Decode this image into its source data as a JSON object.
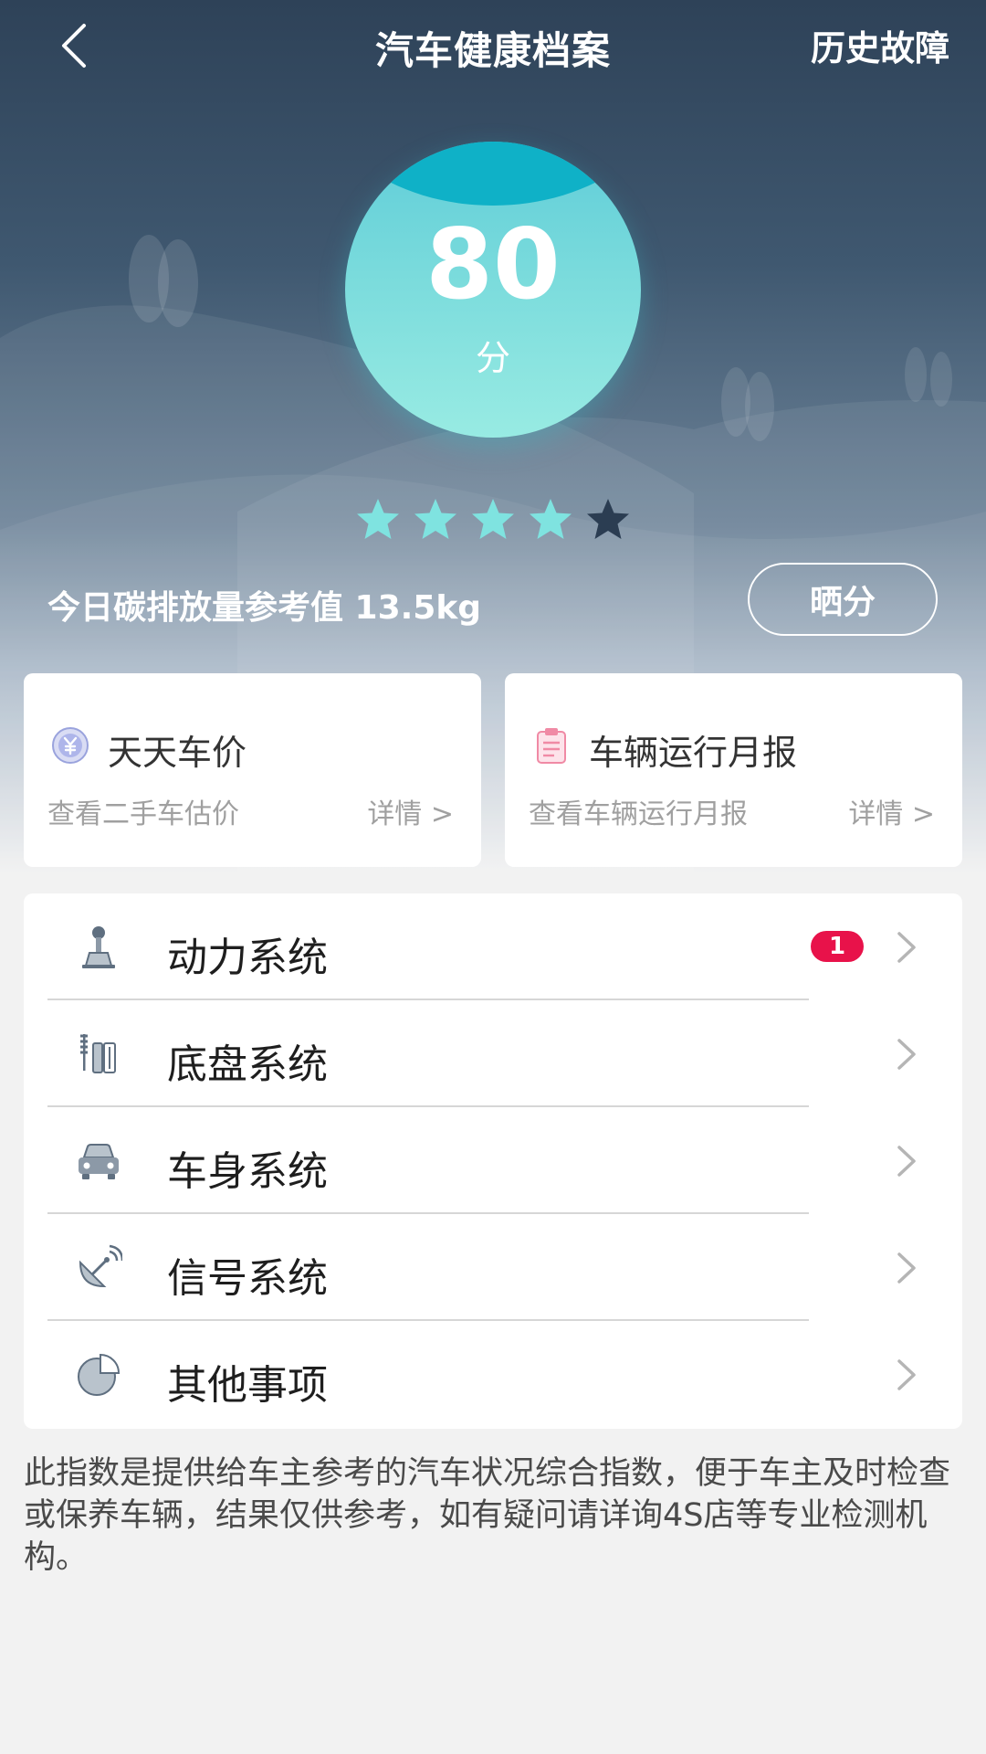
{
  "header": {
    "title": "汽车健康档案",
    "history_label": "历史故障"
  },
  "score": {
    "value": "80",
    "unit": "分",
    "stars_filled": 4,
    "stars_total": 5
  },
  "carbon": {
    "text": "今日碳排放量参考值 13.5kg"
  },
  "share_label": "晒分",
  "cards": [
    {
      "title": "天天车价",
      "subtitle": "查看二手车估价",
      "more": "详情 >",
      "icon": "yuan-coin-icon"
    },
    {
      "title": "车辆运行月报",
      "subtitle": "查看车辆运行月报",
      "more": "详情 >",
      "icon": "clipboard-icon"
    }
  ],
  "systems": [
    {
      "label": "动力系统",
      "badge": "1",
      "icon": "gear-shift-icon"
    },
    {
      "label": "底盘系统",
      "badge": "",
      "icon": "suspension-icon"
    },
    {
      "label": "车身系统",
      "badge": "",
      "icon": "car-body-icon"
    },
    {
      "label": "信号系统",
      "badge": "",
      "icon": "satellite-dish-icon"
    },
    {
      "label": "其他事项",
      "badge": "",
      "icon": "pie-chart-icon"
    }
  ],
  "disclaimer": "此指数是提供给车主参考的汽车状况综合指数，便于车主及时检查或保养车辆，结果仅供参考，如有疑问请详询4S店等专业检测机构。",
  "colors": {
    "hero_top": "#2e4258",
    "score_circle": "#7adbdc",
    "star_filled": "#7fe3e0",
    "star_empty": "#2b3d52",
    "badge": "#e8124a"
  }
}
